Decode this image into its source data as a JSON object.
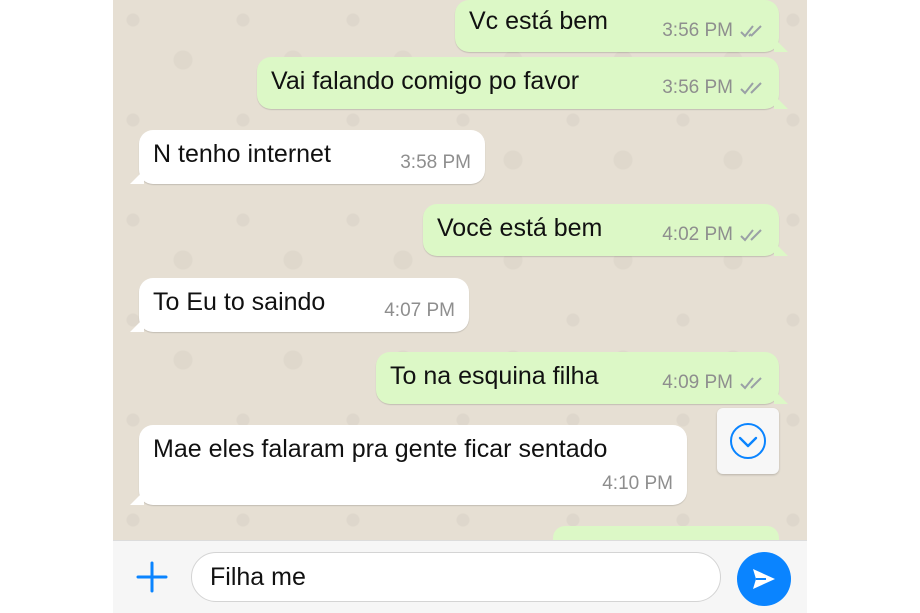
{
  "messages": [
    {
      "dir": "out",
      "text": "Vc está bem",
      "time": "3:56 PM",
      "read": true
    },
    {
      "dir": "out",
      "text": "Vai falando comigo po favor",
      "time": "3:56 PM",
      "read": true
    },
    {
      "dir": "in",
      "text": "N tenho internet",
      "time": "3:58 PM"
    },
    {
      "dir": "out",
      "text": "Você está bem",
      "time": "4:02 PM",
      "read": true
    },
    {
      "dir": "in",
      "text": "To Eu to saindo",
      "time": "4:07 PM"
    },
    {
      "dir": "out",
      "text": "To na esquina filha",
      "time": "4:09 PM",
      "read": true
    },
    {
      "dir": "in",
      "text": "Mae eles falaram pra gente ficar sentado",
      "time": "4:10 PM"
    }
  ],
  "composer": {
    "value": "Filha me",
    "plus_icon": "plus-icon",
    "send_icon": "send-icon"
  },
  "colors": {
    "outgoing_bubble": "#dcf8c6",
    "incoming_bubble": "#ffffff",
    "accent": "#0a84ff",
    "chat_background": "#e6dfd3"
  }
}
